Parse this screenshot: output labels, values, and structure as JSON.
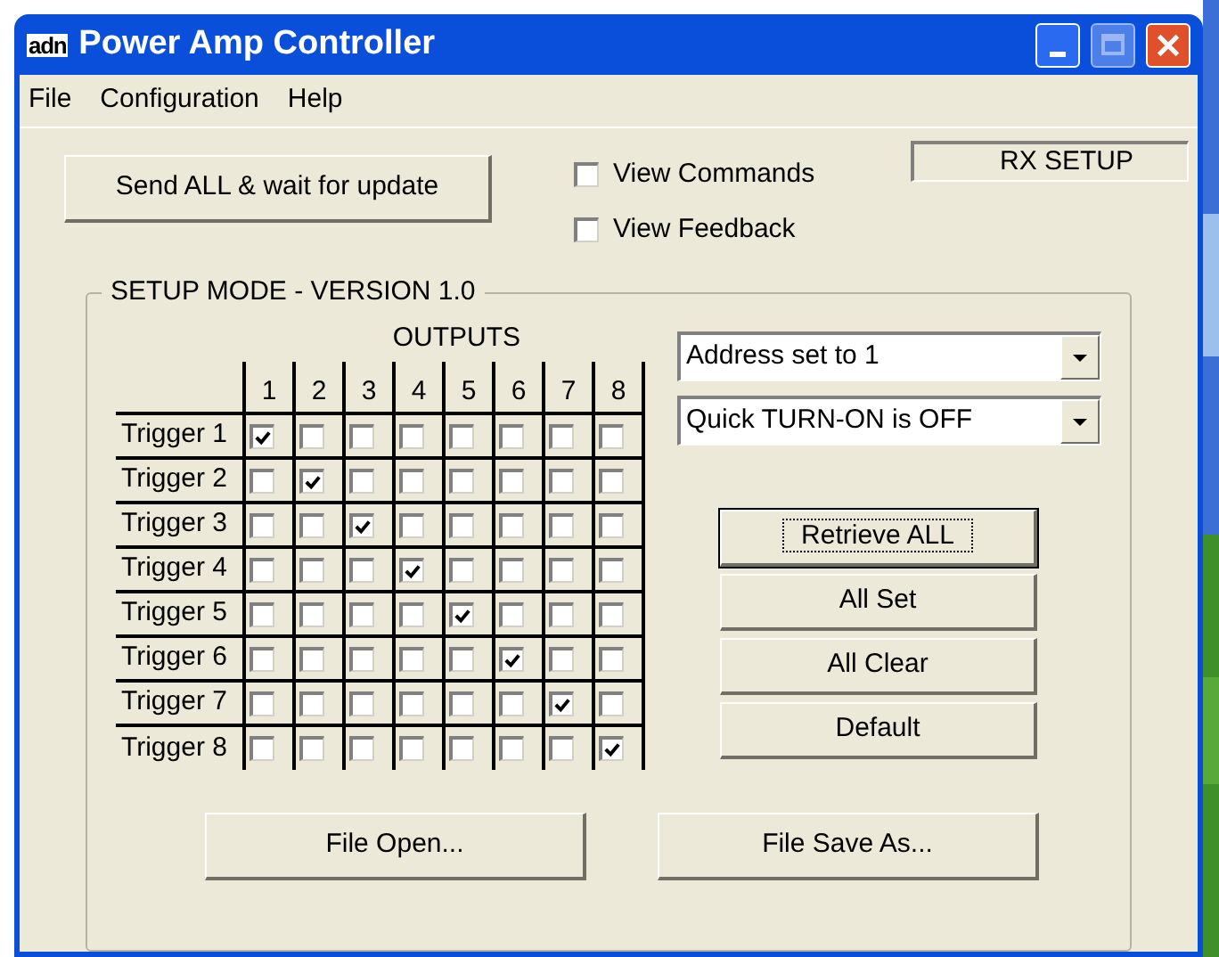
{
  "window": {
    "title": "Power Amp Controller",
    "logo": "adn"
  },
  "menu": [
    "File",
    "Configuration",
    "Help"
  ],
  "send_button": "Send ALL & wait for update",
  "view_options": [
    {
      "label": "View Commands",
      "checked": false
    },
    {
      "label": "View Feedback",
      "checked": false
    }
  ],
  "status": "RX SETUP",
  "group": {
    "title": "SETUP MODE - VERSION 1.0",
    "outputs_label": "OUTPUTS",
    "columns": [
      "1",
      "2",
      "3",
      "4",
      "5",
      "6",
      "7",
      "8"
    ],
    "rows": [
      {
        "label": "Trigger 1",
        "checks": [
          true,
          false,
          false,
          false,
          false,
          false,
          false,
          false
        ]
      },
      {
        "label": "Trigger 2",
        "checks": [
          false,
          true,
          false,
          false,
          false,
          false,
          false,
          false
        ]
      },
      {
        "label": "Trigger 3",
        "checks": [
          false,
          false,
          true,
          false,
          false,
          false,
          false,
          false
        ]
      },
      {
        "label": "Trigger 4",
        "checks": [
          false,
          false,
          false,
          true,
          false,
          false,
          false,
          false
        ]
      },
      {
        "label": "Trigger 5",
        "checks": [
          false,
          false,
          false,
          false,
          true,
          false,
          false,
          false
        ]
      },
      {
        "label": "Trigger 6",
        "checks": [
          false,
          false,
          false,
          false,
          false,
          true,
          false,
          false
        ]
      },
      {
        "label": "Trigger 7",
        "checks": [
          false,
          false,
          false,
          false,
          false,
          false,
          true,
          false
        ]
      },
      {
        "label": "Trigger 8",
        "checks": [
          false,
          false,
          false,
          false,
          false,
          false,
          false,
          true
        ]
      }
    ],
    "dropdowns": [
      "Address set to 1",
      "Quick TURN-ON is OFF"
    ],
    "buttons": [
      {
        "label": "Retrieve ALL",
        "focused": true
      },
      {
        "label": "All Set",
        "focused": false
      },
      {
        "label": "All Clear",
        "focused": false
      },
      {
        "label": "Default",
        "focused": false
      }
    ],
    "file_buttons": [
      "File Open...",
      "File Save As..."
    ]
  }
}
